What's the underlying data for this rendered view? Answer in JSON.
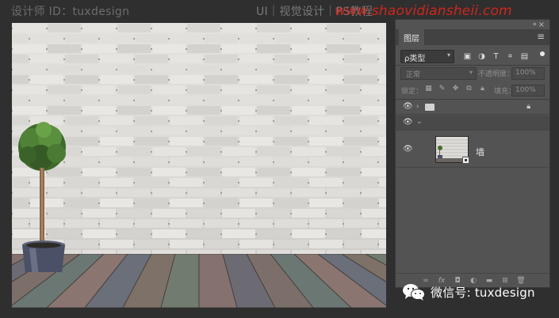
{
  "top": {
    "designer": "设计师 ID：tuxdesign",
    "course": "UI｜视觉设计｜PS教程",
    "watermark": "www.shaovidiansheii.com"
  },
  "layers_panel": {
    "tab_label": "图层",
    "filter_label": "ρ类型",
    "filter_icons": [
      "image-filter-icon",
      "adjustment-filter-icon",
      "type-filter-icon",
      "shape-filter-icon",
      "smart-object-filter-icon"
    ],
    "blend_mode": "正常",
    "opacity_label": "不透明度：",
    "opacity_value": "100%",
    "lock_label": "锁定：",
    "fill_label": "填充：",
    "fill_value": "100%",
    "layers": [
      {
        "kind": "group",
        "name": "",
        "visible": true,
        "expanded": false,
        "locked": true
      },
      {
        "kind": "group",
        "name": "",
        "visible": true,
        "expanded": true,
        "locked": false
      },
      {
        "kind": "smart-object",
        "name": "墙",
        "visible": true
      }
    ],
    "footer_icons": [
      "link-layers-icon",
      "fx-icon",
      "add-mask-icon",
      "adjustment-layer-icon",
      "new-group-icon",
      "new-layer-icon",
      "delete-layer-icon"
    ]
  },
  "credit": {
    "wechat": "微信号: tuxdesign"
  },
  "colors": {
    "watermark": "#e0261d",
    "panel_bg": "#535353",
    "app_bg": "#2f2f2f"
  }
}
